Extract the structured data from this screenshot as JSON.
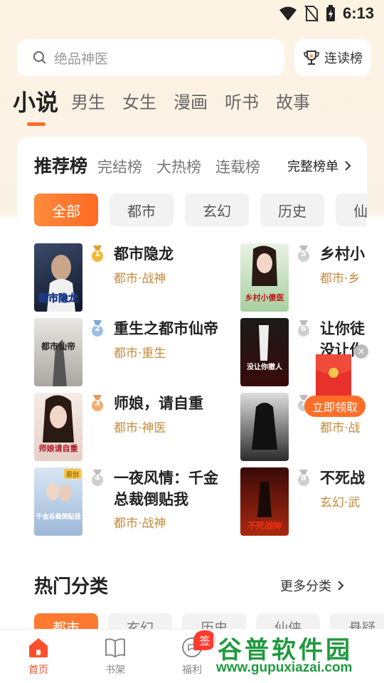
{
  "status": {
    "time": "6:13"
  },
  "search": {
    "placeholder": "绝品神医",
    "rank_label": "连读榜"
  },
  "tabs": [
    "小说",
    "男生",
    "女生",
    "漫画",
    "听书",
    "故事"
  ],
  "ranking": {
    "tabs": [
      "推荐榜",
      "完结榜",
      "大热榜",
      "连载榜"
    ],
    "full_list": "完整榜单",
    "chips": [
      "全部",
      "都市",
      "玄幻",
      "历史",
      "仙侠"
    ],
    "books": [
      {
        "rank": "1",
        "title": "都市隐龙",
        "tag": "都市·战神",
        "cover_text": "都市隐龙"
      },
      {
        "rank": "2",
        "title": "重生之都市仙帝",
        "tag": "都市·重生",
        "cover_text": "都市仙帝"
      },
      {
        "rank": "3",
        "title": "师娘，请自重",
        "tag": "都市·神医",
        "cover_text": "师娘请自重"
      },
      {
        "rank": "4",
        "title": "一夜风情：千金总裁倒贴我",
        "tag": "都市·战神",
        "cover_text": "千金总裁倒贴我",
        "cover_badge": "原创"
      },
      {
        "rank": "5",
        "title": "乡村小",
        "tag": "都市·乡",
        "cover_text": "乡村小傻医"
      },
      {
        "rank": "6",
        "title": "让你徒",
        "title2": "没让你",
        "tag": "",
        "cover_text": "没让你撤人"
      },
      {
        "rank": "7",
        "title": "",
        "tag": "都市·战",
        "cover_text": ""
      },
      {
        "rank": "8",
        "title": "不死战",
        "tag": "玄幻·武",
        "cover_text": "不死战神"
      }
    ]
  },
  "red_packet": {
    "button": "立即领取"
  },
  "hot": {
    "title": "热门分类",
    "more": "更多分类",
    "chips": [
      "都市",
      "玄幻",
      "历史",
      "仙侠",
      "悬疑"
    ]
  },
  "nav": {
    "home": "首页",
    "shelf": "书架",
    "welfare": "福利",
    "sign": "签"
  },
  "watermark": {
    "cn": "谷普软件园",
    "url": "www.gupuxiazai.com"
  },
  "colors": {
    "accent": "#ff6a2b",
    "tag": "#c58a3a",
    "nav_active": "#ff4d2d"
  }
}
